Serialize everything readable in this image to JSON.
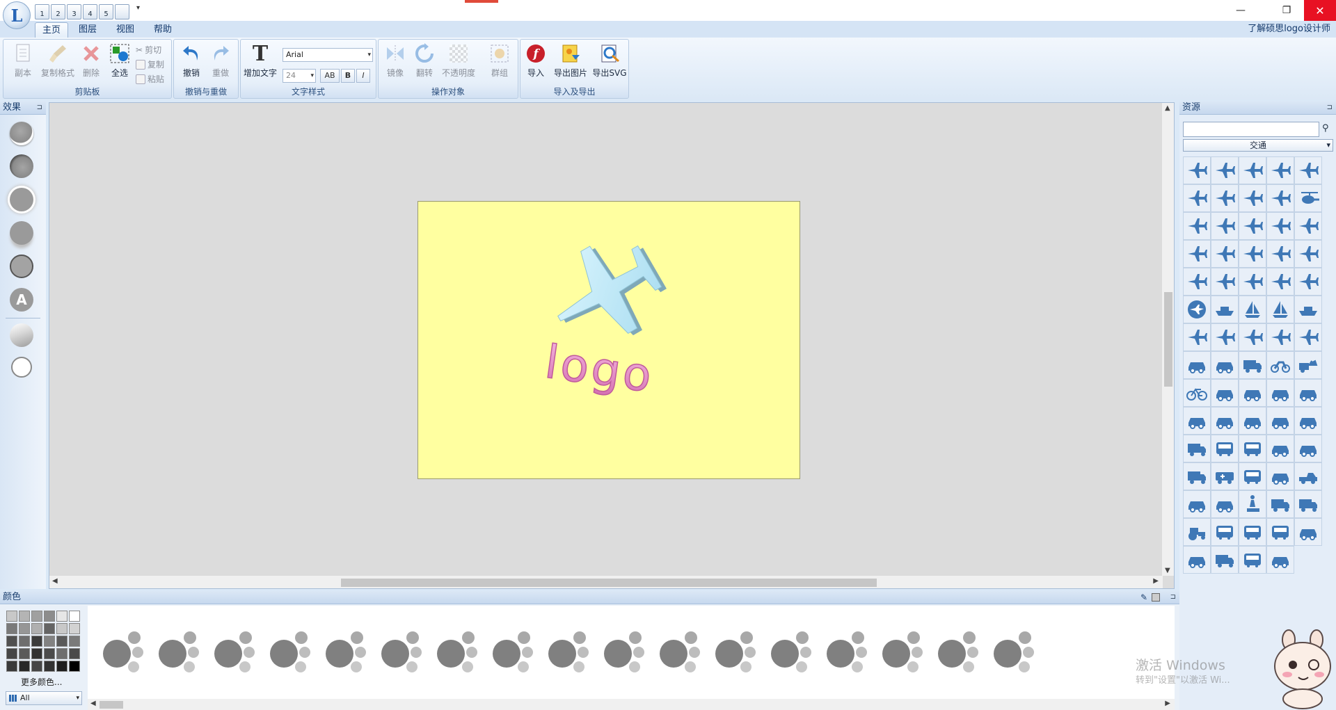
{
  "titlebar": {
    "qat_buttons": [
      "1",
      "2",
      "3",
      "4",
      "5",
      ""
    ],
    "minimize_glyph": "—",
    "maximize_glyph": "❐",
    "close_glyph": "✕"
  },
  "tabs": [
    {
      "label": "主页",
      "active": true
    },
    {
      "label": "图层",
      "active": false
    },
    {
      "label": "视图",
      "active": false
    },
    {
      "label": "帮助",
      "active": false
    }
  ],
  "about_link": "了解硕思logo设计师",
  "ribbon": {
    "clipboard": {
      "group_label": "剪贴板",
      "duplicate": "副本",
      "copy_format": "复制格式",
      "delete": "删除",
      "select_all": "全选",
      "cut": "剪切",
      "copy": "复制",
      "paste": "粘贴"
    },
    "undo_redo": {
      "group_label": "撤销与重做",
      "undo": "撤销",
      "redo": "重做"
    },
    "text_style": {
      "group_label": "文字样式",
      "add_text": "增加文字",
      "font_name": "Arial",
      "font_size": "24",
      "spacing": "AB",
      "bold": "B",
      "italic": "I"
    },
    "operate": {
      "group_label": "操作对象",
      "mirror": "镜像",
      "flip": "翻转",
      "opacity": "不透明度",
      "group": "群组"
    },
    "import_export": {
      "group_label": "导入及导出",
      "import": "导入",
      "export_image": "导出图片",
      "export_svg": "导出SVG"
    }
  },
  "left_panel": {
    "title": "效果",
    "effect_letter": "A"
  },
  "canvas": {
    "logo_text": "logo",
    "doc_color": "#ffffa0"
  },
  "right_panel": {
    "title": "资源",
    "search_value": "",
    "category": "交通",
    "icons": [
      "plane",
      "plane",
      "plane",
      "plane",
      "plane",
      "plane",
      "plane",
      "plane",
      "plane",
      "helicopter",
      "plane",
      "plane",
      "plane",
      "plane",
      "plane",
      "plane",
      "plane",
      "plane",
      "plane",
      "plane",
      "plane",
      "plane",
      "plane",
      "plane",
      "plane",
      "globe-plane",
      "ship",
      "sailboat",
      "sailboat",
      "ship",
      "plane",
      "plane",
      "plane",
      "plane",
      "plane",
      "car",
      "car",
      "truck",
      "motorcycle",
      "horse-cart",
      "bicycle",
      "car",
      "car",
      "car",
      "car",
      "car",
      "car",
      "car",
      "car",
      "car",
      "truck",
      "bus",
      "bus",
      "car",
      "car",
      "truck",
      "ambulance",
      "bus",
      "car",
      "pickup",
      "car",
      "car",
      "worker",
      "truck",
      "truck",
      "tractor",
      "bus",
      "bus",
      "bus",
      "car",
      "car",
      "truck",
      "bus",
      "car"
    ]
  },
  "color_panel": {
    "title": "颜色",
    "more_colors": "更多颜色...",
    "filter": "All",
    "palette": [
      "#c8c8c8",
      "#b4b4b4",
      "#a0a0a0",
      "#8c8c8c",
      "#e6e6e6",
      "#ffffff",
      "#7a7a7a",
      "#969696",
      "#b0b0b0",
      "#646464",
      "#c8c8c8",
      "#d2d2d2",
      "#505050",
      "#6e6e6e",
      "#3c3c3c",
      "#828282",
      "#5a5a5a",
      "#7a7a7a",
      "#464646",
      "#5a5a5a",
      "#323232",
      "#4b4b4b",
      "#6e6e6e",
      "#4a4a4a",
      "#3a3a3a",
      "#282828",
      "#464646",
      "#323232",
      "#1e1e1e",
      "#000000"
    ]
  },
  "watermark": {
    "line1": "激活 Windows",
    "line2": "转到\"设置\"以激活 Wi..."
  }
}
